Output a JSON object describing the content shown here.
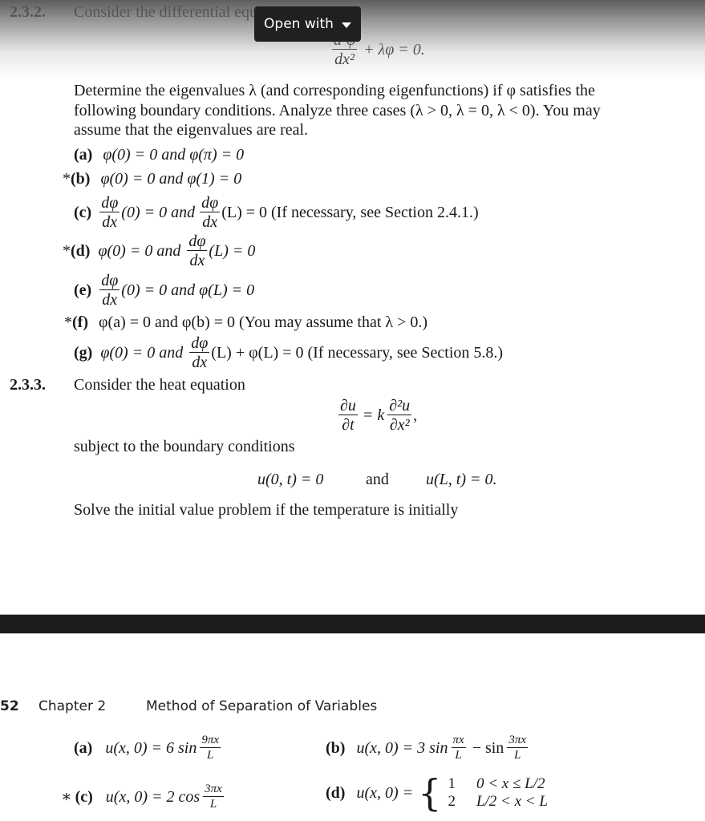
{
  "viewer": {
    "open_with_label": "Open with",
    "open_with_icon": "caret-down-icon"
  },
  "problem_232": {
    "number": "2.3.2.",
    "intro": "Consider the differential equation",
    "equation": {
      "num": "d²φ",
      "den": "dx²",
      "rest": "+ λφ = 0."
    },
    "paragraph_lines": [
      "Determine the eigenvalues λ (and corresponding eigenfunctions) if φ satisfies the",
      "following boundary conditions. Analyze three cases (λ > 0, λ = 0, λ < 0). You may",
      "assume that the eigenvalues are real."
    ],
    "parts": [
      {
        "marker": "",
        "label": "(a)",
        "text": "φ(0) = 0 and φ(π) = 0"
      },
      {
        "marker": "*",
        "label": "(b)",
        "text": "φ(0) = 0 and φ(1) = 0"
      },
      {
        "marker": "",
        "label": "(c)",
        "pre": "(0) = 0 and",
        "post": "(L) = 0 (If necessary, see Section 2.4.1.)"
      },
      {
        "marker": "*",
        "label": "(d)",
        "pre": "φ(0) = 0 and",
        "post": "(L) = 0"
      },
      {
        "marker": "",
        "label": "(e)",
        "post": "(0) = 0 and φ(L) = 0"
      },
      {
        "marker": "*",
        "label": "(f)",
        "text": "φ(a) = 0 and φ(b) = 0 (You may assume that λ > 0.)"
      },
      {
        "marker": "",
        "label": "(g)",
        "pre": "φ(0) = 0 and",
        "post": "(L) + φ(L) = 0 (If necessary, see Section 5.8.)"
      }
    ],
    "deriv_num": "dφ",
    "deriv_den": "dx"
  },
  "problem_233": {
    "number": "2.3.3.",
    "intro": "Consider the heat equation",
    "heat_eq": {
      "lhs_num": "∂u",
      "lhs_den": "∂t",
      "eq": "= k",
      "rhs_num": "∂²u",
      "rhs_den": "∂x²",
      "trail": ","
    },
    "bc_intro": "subject to the boundary conditions",
    "bc_left": "u(0, t) = 0",
    "bc_and": "and",
    "bc_right": "u(L, t) = 0.",
    "solve_text": "Solve the initial value problem if the temperature is initially"
  },
  "page_header": {
    "page_number": "52",
    "chapter": "Chapter 2",
    "chapter_title": "Method of Separation of Variables"
  },
  "initial_conditions": {
    "a": {
      "marker": "",
      "label": "(a)",
      "lhs": "u(x, 0) = 6 sin",
      "frac_num": "9πx",
      "frac_den": "L"
    },
    "b": {
      "marker": "",
      "label": "(b)",
      "lhs": "u(x, 0) = 3 sin",
      "frac1_num": "πx",
      "frac1_den": "L",
      "mid": "− sin",
      "frac2_num": "3πx",
      "frac2_den": "L"
    },
    "c": {
      "marker": "∗",
      "label": "(c)",
      "lhs": "u(x, 0) = 2 cos",
      "frac_num": "3πx",
      "frac_den": "L"
    },
    "d": {
      "marker": "",
      "label": "(d)",
      "lhs": "u(x, 0) =",
      "cases": [
        {
          "value": "1",
          "condition": "0 < x ≤ L/2"
        },
        {
          "value": "2",
          "condition": "L/2 < x < L"
        }
      ]
    }
  }
}
